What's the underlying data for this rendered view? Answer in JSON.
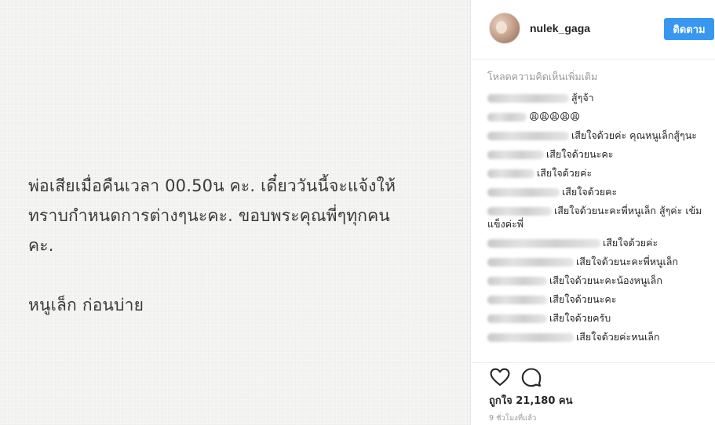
{
  "post": {
    "text_lines": [
      "พ่อเสียเมื่อคืนเวลา 00.50น คะ. เดี๋ยววันนี้จะแจ้งให้",
      "ทราบกำหนดการต่างๆนะคะ. ขอบพระคุณพี่ๆทุกคน",
      "คะ."
    ],
    "signature": "หนูเล็ก ก่อนบ่าย"
  },
  "header": {
    "username": "nulek_gaga",
    "follow_label": "ติดตาม"
  },
  "comments": {
    "load_more": "โหลดความคิดเห็นเพิ่มเติม",
    "items": [
      {
        "text": "สู้ๆจ้า"
      },
      {
        "text": "😩😩😩😩😩"
      },
      {
        "text": "เสียใจด้วยค่ะ คุณหนูเล็กสู้ๆนะ"
      },
      {
        "text": "เสียใจด้วยนะคะ"
      },
      {
        "text": "เสียใจด้วยค่ะ"
      },
      {
        "text": "เสียใจด้วยคะ"
      },
      {
        "text": "เสียใจด้วยนะคะพี่หนูเล็ก สู้ๆค่ะ เข้มแข็งค่ะพี่"
      },
      {
        "text": "เสียใจด้วยค่ะ"
      },
      {
        "text": "เสียใจด้วยนะคะพี่หนูเล็ก"
      },
      {
        "text": "เสียใจด้วยนะคะน้องหนูเล็ก"
      },
      {
        "text": "เสียใจด้วยนะคะ"
      },
      {
        "text": "เสียใจด้วยครับ"
      },
      {
        "text": "เสียใจด้วยค่ะหนเล็ก"
      }
    ]
  },
  "footer": {
    "likes": "ถูกใจ 21,180 คน",
    "time": "9 ชั่วโมงที่แล้ว"
  },
  "icons": {
    "like": "heart-outline-icon",
    "comment": "comment-bubble-icon"
  },
  "colors": {
    "follow_button": "#3897f0",
    "muted_text": "#999999"
  }
}
